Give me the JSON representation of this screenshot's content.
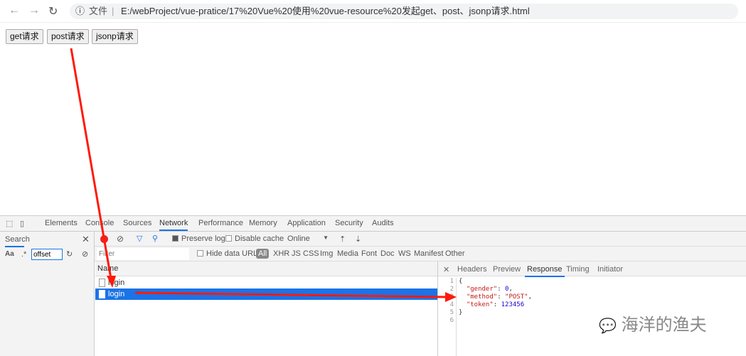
{
  "browser": {
    "back_icon": "arrow-left",
    "forward_icon": "arrow-right",
    "reload_icon": "reload",
    "info_icon": "info",
    "file_label": "文件",
    "url": "E:/webProject/vue-pratice/17%20Vue%20使用%20vue-resource%20发起get、post、jsonp请求.html"
  },
  "page": {
    "buttons": [
      "get请求",
      "post请求",
      "jsonp请求"
    ]
  },
  "devtools": {
    "tabs": [
      "Elements",
      "Console",
      "Sources",
      "Network",
      "Performance",
      "Memory",
      "Application",
      "Security",
      "Audits"
    ],
    "active_tab": "Network",
    "search": {
      "title": "Search",
      "aa": "Aa",
      "regex": ".*",
      "value": "offset"
    },
    "toolbar": {
      "preserve_log": "Preserve log",
      "preserve_checked": true,
      "disable_cache": "Disable cache",
      "throttle": "Online"
    },
    "filter": {
      "placeholder": "Filter",
      "hide_data_urls": "Hide data URLs",
      "types": [
        "All",
        "XHR",
        "JS",
        "CSS",
        "Img",
        "Media",
        "Font",
        "Doc",
        "WS",
        "Manifest",
        "Other"
      ]
    },
    "requests": {
      "header": "Name",
      "rows": [
        "login",
        "login"
      ],
      "selected": 1
    },
    "detail": {
      "tabs": [
        "Headers",
        "Preview",
        "Response",
        "Timing",
        "Initiator"
      ],
      "active": "Response",
      "lines": [
        "1",
        "2",
        "3",
        "4",
        "5",
        "6"
      ],
      "response": {
        "open": "{",
        "gender_key": "\"gender\"",
        "gender_val": "0",
        "method_key": "\"method\"",
        "method_val": "\"POST\"",
        "token_key": "\"token\"",
        "token_val": "123456",
        "close": "}"
      }
    }
  },
  "watermark": "海洋的渔夫",
  "colors": {
    "accent": "#1a73e8",
    "selected_row": "#1a73e8",
    "arrow": "#ff1a0a"
  }
}
